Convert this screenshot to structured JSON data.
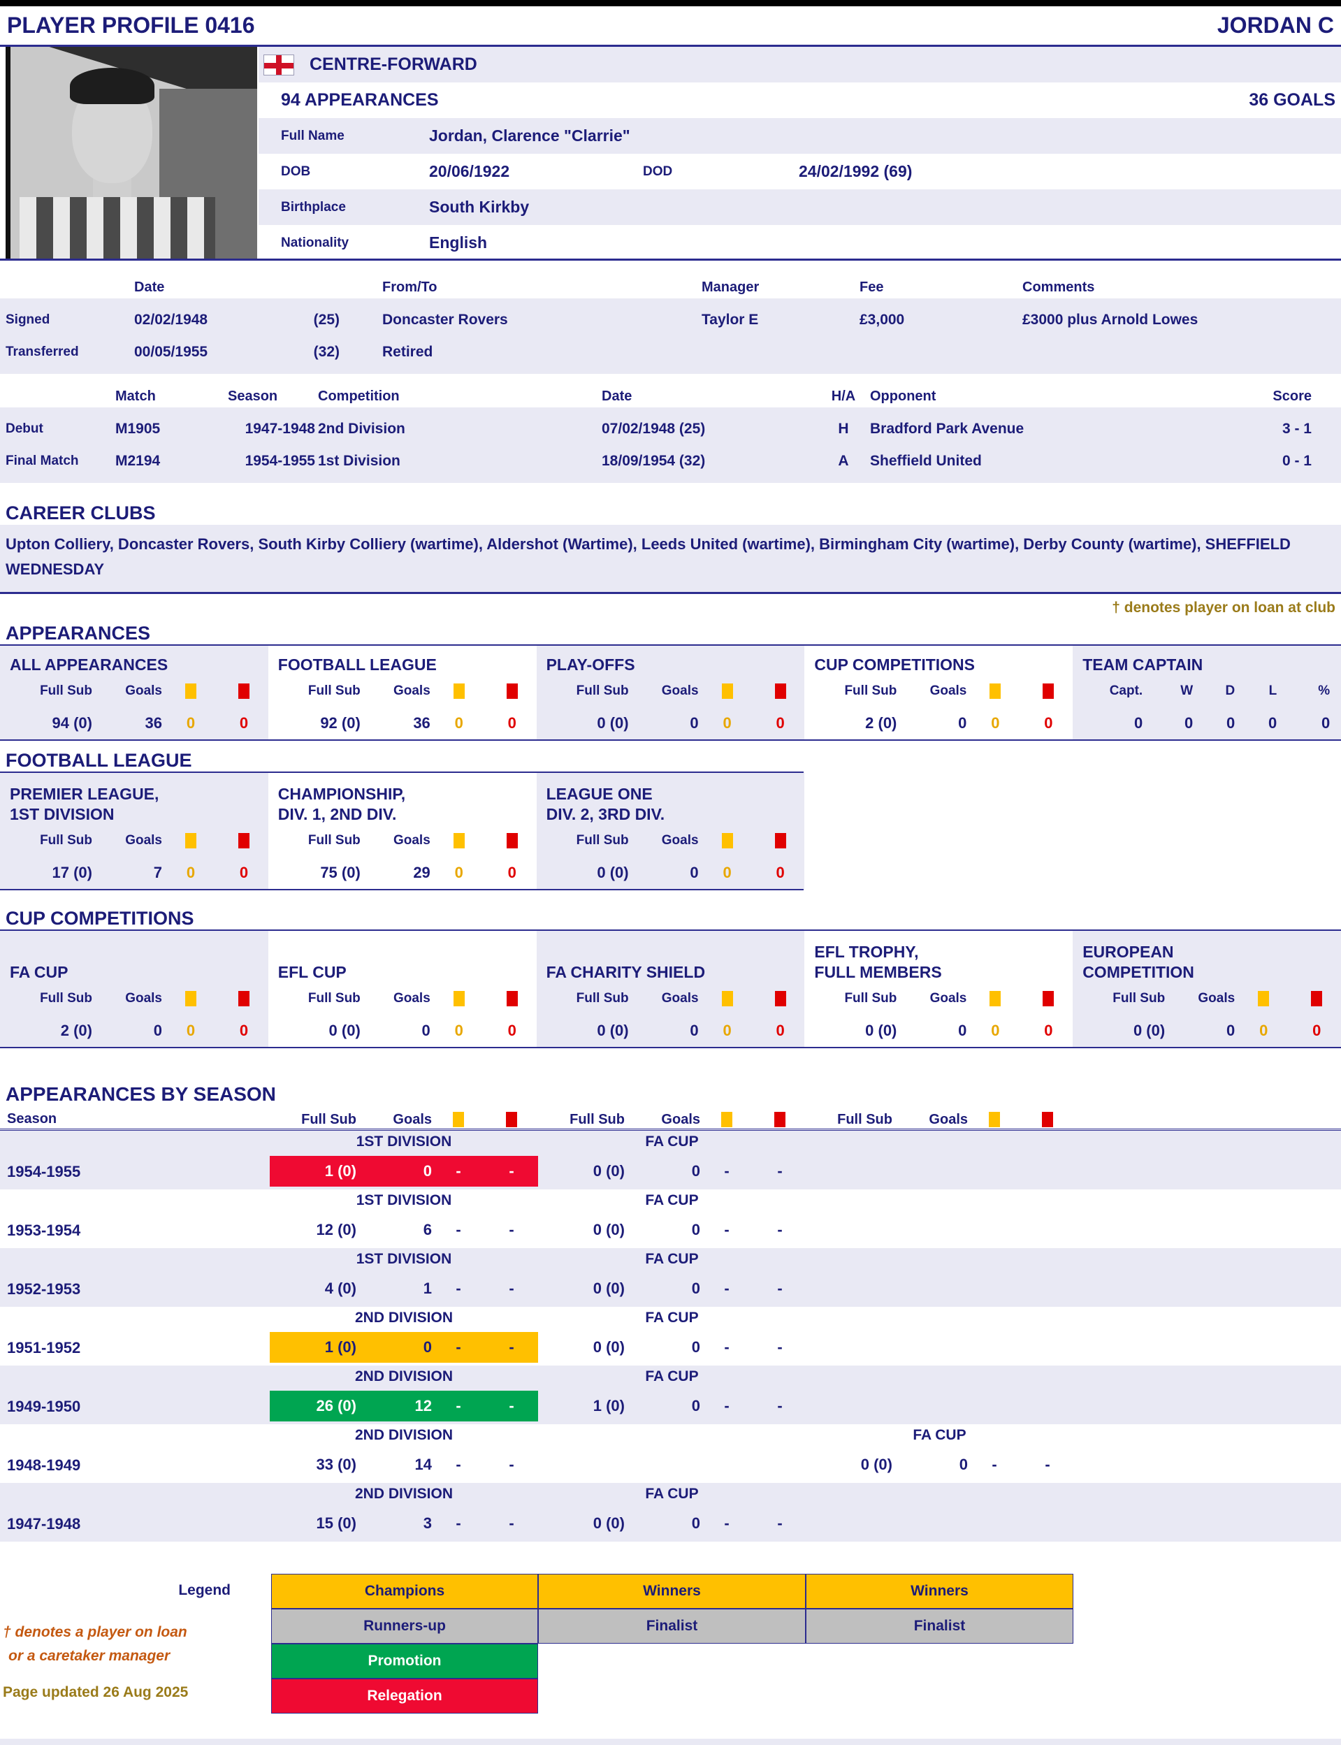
{
  "header": {
    "title": "PLAYER PROFILE 0416",
    "player": "JORDAN C"
  },
  "profile": {
    "flag": "england-flag",
    "position": "CENTRE-FORWARD",
    "appearances": "94 APPEARANCES",
    "goals": "36 GOALS",
    "full_name_label": "Full Name",
    "full_name": "Jordan, Clarence \"Clarrie\"",
    "dob_label": "DOB",
    "dob": "20/06/1922",
    "dod_label": "DOD",
    "dod": "24/02/1992 (69)",
    "birthplace_label": "Birthplace",
    "birthplace": "South Kirkby",
    "nationality_label": "Nationality",
    "nationality": "English"
  },
  "transfers": {
    "headers": {
      "date": "Date",
      "fromto": "From/To",
      "manager": "Manager",
      "fee": "Fee",
      "comments": "Comments"
    },
    "rows": [
      {
        "label": "Signed",
        "date": "02/02/1948",
        "age": "(25)",
        "fromto": "Doncaster Rovers",
        "manager": "Taylor E",
        "fee": "£3,000",
        "comments": "£3000 plus Arnold Lowes"
      },
      {
        "label": "Transferred",
        "date": "00/05/1955",
        "age": "(32)",
        "fromto": "Retired",
        "manager": "",
        "fee": "",
        "comments": ""
      }
    ]
  },
  "milestones": {
    "headers": {
      "match": "Match",
      "season": "Season",
      "competition": "Competition",
      "date": "Date",
      "ha": "H/A",
      "opponent": "Opponent",
      "score": "Score"
    },
    "rows": [
      {
        "label": "Debut",
        "match": "M1905",
        "season": "1947-1948",
        "competition": "2nd Division",
        "date": "07/02/1948 (25)",
        "ha": "H",
        "opponent": "Bradford Park Avenue",
        "score": "3 - 1"
      },
      {
        "label": "Final Match",
        "match": "M2194",
        "season": "1954-1955",
        "competition": "1st Division",
        "date": "18/09/1954 (32)",
        "ha": "A",
        "opponent": "Sheffield United",
        "score": "0 - 1"
      }
    ]
  },
  "career_clubs": {
    "title": "CAREER CLUBS",
    "text": "Upton Colliery, Doncaster Rovers, South Kirby Colliery (wartime), Aldershot (Wartime), Leeds United (wartime), Birmingham City (wartime), Derby County (wartime), SHEFFIELD WEDNESDAY"
  },
  "loan_note": "† denotes player on loan at club",
  "labels": {
    "full_sub": "Full Sub",
    "goals": "Goals"
  },
  "appearances_section": {
    "title": "APPEARANCES",
    "blocks": [
      {
        "title": "ALL APPEARANCES",
        "full_sub": "94 (0)",
        "goals": "36",
        "yellow": "0",
        "red": "0"
      },
      {
        "title": "FOOTBALL LEAGUE",
        "full_sub": "92 (0)",
        "goals": "36",
        "yellow": "0",
        "red": "0"
      },
      {
        "title": "PLAY-OFFS",
        "full_sub": "0 (0)",
        "goals": "0",
        "yellow": "0",
        "red": "0"
      },
      {
        "title": "CUP COMPETITIONS",
        "full_sub": "2 (0)",
        "goals": "0",
        "yellow": "0",
        "red": "0"
      }
    ],
    "captain": {
      "title": "TEAM CAPTAIN",
      "cols": [
        "Capt.",
        "W",
        "D",
        "L",
        "%"
      ],
      "values": [
        "0",
        "0",
        "0",
        "0",
        "0"
      ]
    }
  },
  "football_league_section": {
    "title": "FOOTBALL LEAGUE",
    "blocks": [
      {
        "title1": "PREMIER LEAGUE,",
        "title2": "1ST DIVISION",
        "full_sub": "17 (0)",
        "goals": "7",
        "yellow": "0",
        "red": "0"
      },
      {
        "title1": "CHAMPIONSHIP,",
        "title2": "DIV. 1, 2ND DIV.",
        "full_sub": "75 (0)",
        "goals": "29",
        "yellow": "0",
        "red": "0"
      },
      {
        "title1": "LEAGUE ONE",
        "title2": "DIV. 2, 3RD DIV.",
        "full_sub": "0 (0)",
        "goals": "0",
        "yellow": "0",
        "red": "0"
      }
    ]
  },
  "cup_section": {
    "title": "CUP COMPETITIONS",
    "blocks": [
      {
        "title2": "FA CUP",
        "full_sub": "2 (0)",
        "goals": "0",
        "yellow": "0",
        "red": "0"
      },
      {
        "title2": "EFL CUP",
        "full_sub": "0 (0)",
        "goals": "0",
        "yellow": "0",
        "red": "0"
      },
      {
        "title2": "FA CHARITY SHIELD",
        "full_sub": "0 (0)",
        "goals": "0",
        "yellow": "0",
        "red": "0"
      },
      {
        "title1": "EFL TROPHY,",
        "title2": "FULL MEMBERS",
        "full_sub": "0 (0)",
        "goals": "0",
        "yellow": "0",
        "red": "0"
      },
      {
        "title1": "EUROPEAN",
        "title2": "COMPETITION",
        "full_sub": "0 (0)",
        "goals": "0",
        "yellow": "0",
        "red": "0"
      }
    ]
  },
  "by_season": {
    "title": "APPEARANCES BY SEASON",
    "season_col": "Season",
    "rows": [
      {
        "season": "1954-1955",
        "league": {
          "name": "1ST DIVISION",
          "full_sub": "1 (0)",
          "goals": "0",
          "y": "-",
          "r": "-",
          "hl": "hl-relegation"
        },
        "cup": {
          "name": "FA CUP",
          "full_sub": "0 (0)",
          "goals": "0",
          "y": "-",
          "r": "-"
        }
      },
      {
        "season": "1953-1954",
        "league": {
          "name": "1ST DIVISION",
          "full_sub": "12 (0)",
          "goals": "6",
          "y": "-",
          "r": "-"
        },
        "cup": {
          "name": "FA CUP",
          "full_sub": "0 (0)",
          "goals": "0",
          "y": "-",
          "r": "-"
        }
      },
      {
        "season": "1952-1953",
        "league": {
          "name": "1ST DIVISION",
          "full_sub": "4 (0)",
          "goals": "1",
          "y": "-",
          "r": "-"
        },
        "cup": {
          "name": "FA CUP",
          "full_sub": "0 (0)",
          "goals": "0",
          "y": "-",
          "r": "-"
        }
      },
      {
        "season": "1951-1952",
        "league": {
          "name": "2ND DIVISION",
          "full_sub": "1 (0)",
          "goals": "0",
          "y": "-",
          "r": "-",
          "hl": "hl-champions"
        },
        "cup": {
          "name": "FA CUP",
          "full_sub": "0 (0)",
          "goals": "0",
          "y": "-",
          "r": "-"
        }
      },
      {
        "season": "1949-1950",
        "league": {
          "name": "2ND DIVISION",
          "full_sub": "26 (0)",
          "goals": "12",
          "y": "-",
          "r": "-",
          "hl": "hl-promotion"
        },
        "cup": {
          "name": "FA CUP",
          "full_sub": "1 (0)",
          "goals": "0",
          "y": "-",
          "r": "-"
        }
      },
      {
        "season": "1948-1949",
        "league": {
          "name": "2ND DIVISION",
          "full_sub": "33 (0)",
          "goals": "14",
          "y": "-",
          "r": "-"
        },
        "cup": {
          "name": "FA CUP",
          "full_sub": "0 (0)",
          "goals": "0",
          "y": "-",
          "r": "-"
        }
      },
      {
        "season": "1947-1948",
        "league": {
          "name": "2ND DIVISION",
          "full_sub": "15 (0)",
          "goals": "3",
          "y": "-",
          "r": "-"
        },
        "cup": {
          "name": "FA CUP",
          "full_sub": "0 (0)",
          "goals": "0",
          "y": "-",
          "r": "-"
        }
      }
    ]
  },
  "legend": {
    "label": "Legend",
    "row_champions": [
      "Champions",
      "Winners",
      "Winners"
    ],
    "row_runnersup": [
      "Runners-up",
      "Finalist",
      "Finalist"
    ],
    "promotion": "Promotion",
    "relegation": "Relegation",
    "note_line1": "† denotes a player on loan",
    "note_line2": "or a caretaker manager",
    "page_updated": "Page updated 26 Aug 2025"
  },
  "colors": {
    "navy": "#1c1c78",
    "lavender": "#e9e9f4",
    "amber": "#ffc000",
    "relegation_red": "#ef0a32",
    "promotion_green": "#00a551",
    "runnersup_grey": "#bfbfbf",
    "card_yellow": "#ffc000",
    "card_red": "#e00000",
    "orange_note": "#c45911",
    "gold_note": "#9a7b1a"
  }
}
